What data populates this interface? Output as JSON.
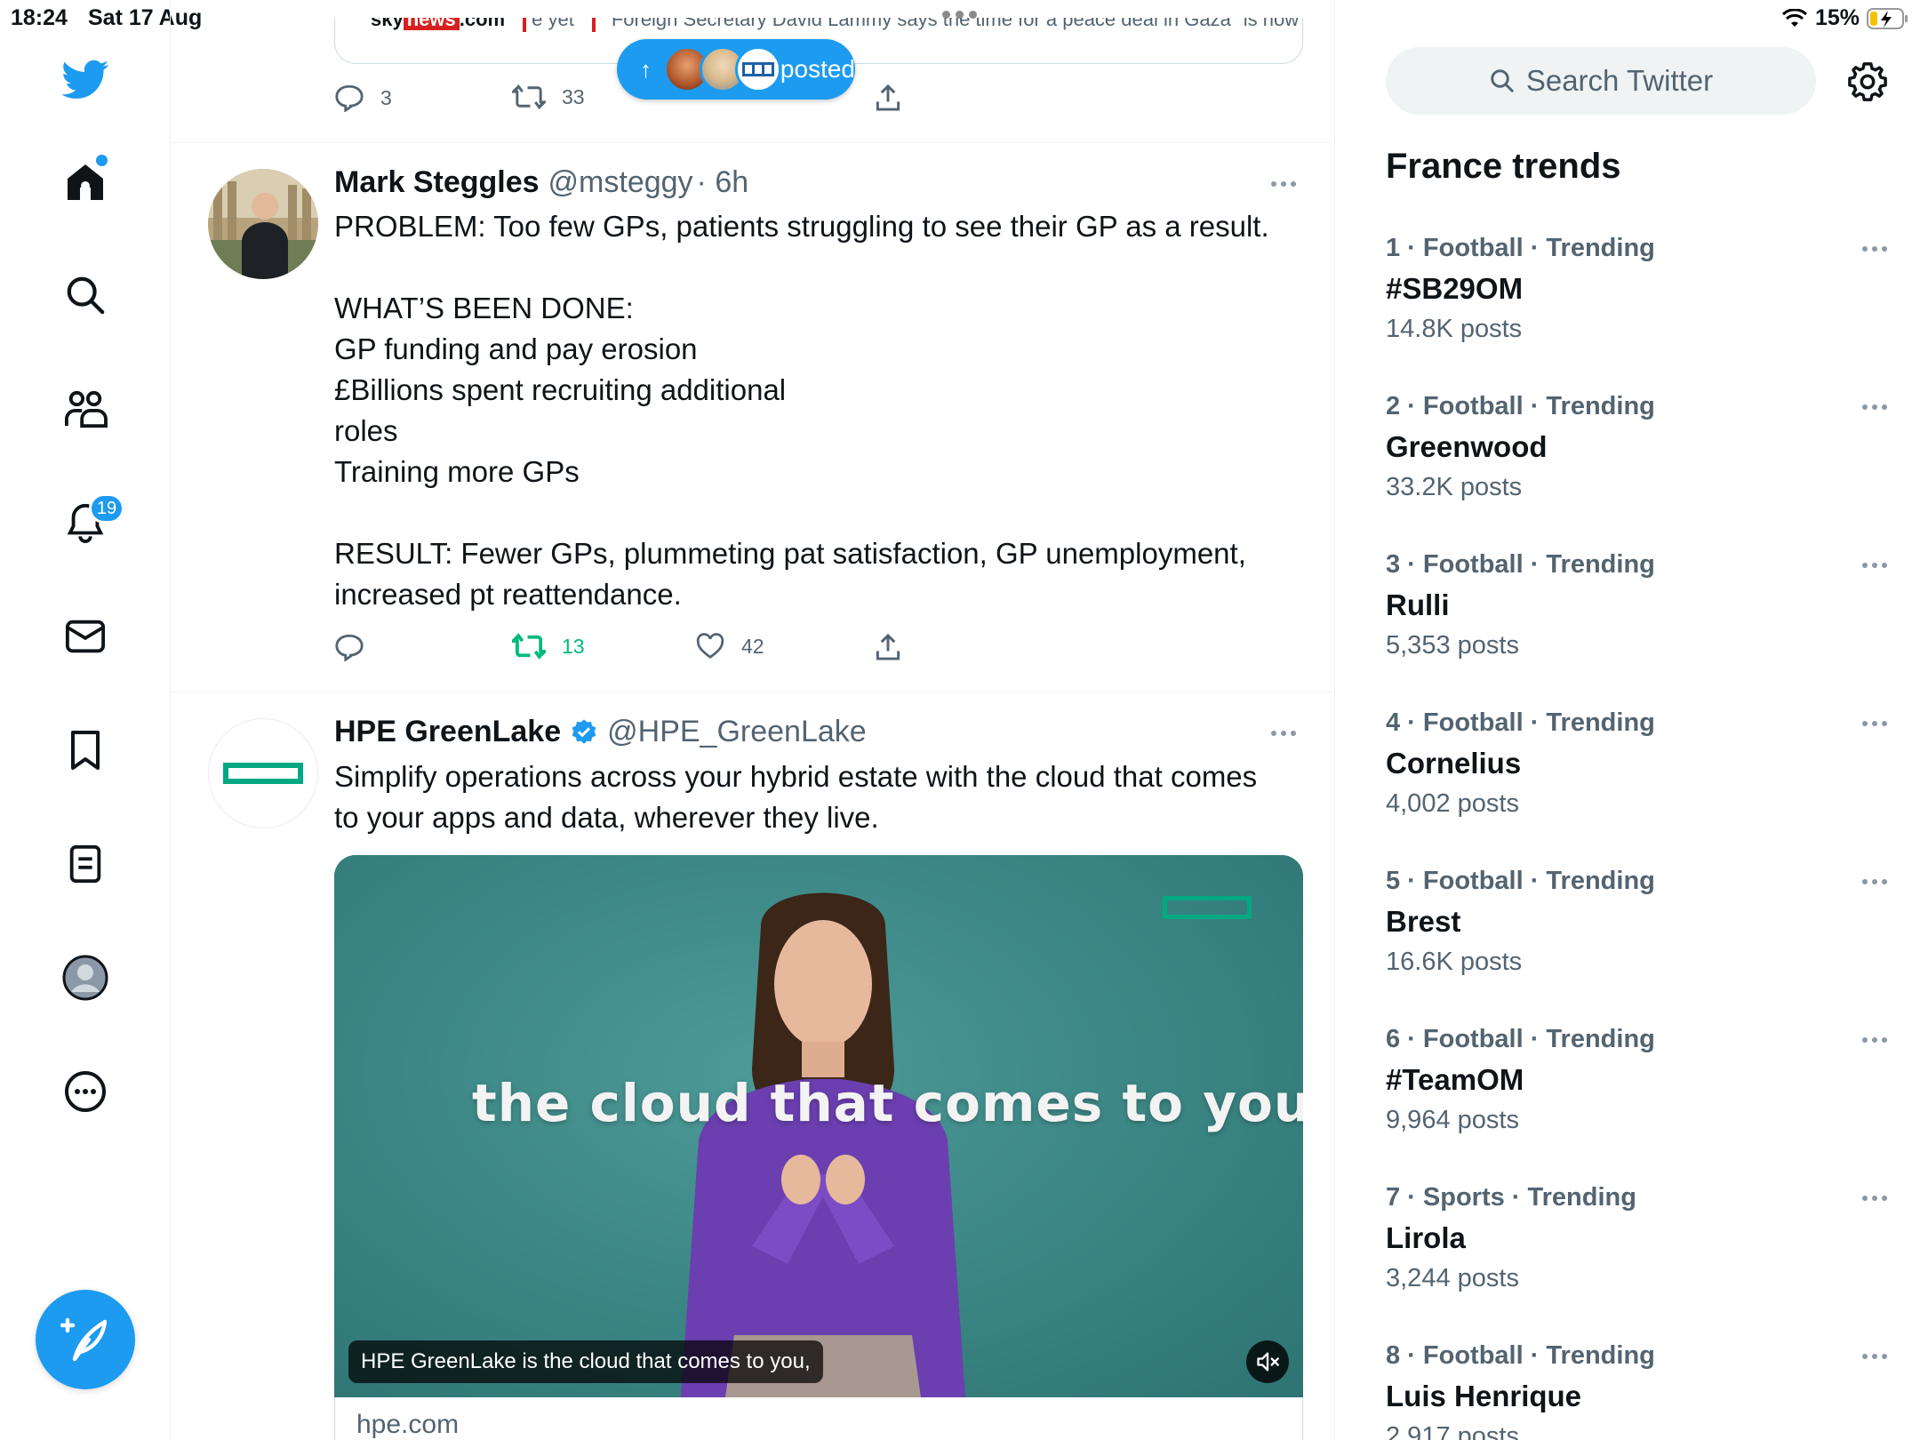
{
  "status_bar": {
    "time": "18:24",
    "date": "Sat 17 Aug",
    "battery": "15%"
  },
  "colors": {
    "accent": "#1d9bf0",
    "retweet_green": "#00ba7c",
    "hpe_green": "#01a982"
  },
  "nav": {
    "items": [
      {
        "icon": "twitter-bird-icon"
      },
      {
        "icon": "home-icon"
      },
      {
        "icon": "search-icon"
      },
      {
        "icon": "communities-icon"
      },
      {
        "icon": "notifications-bell-icon"
      },
      {
        "icon": "messages-envelope-icon"
      },
      {
        "icon": "bookmark-icon"
      },
      {
        "icon": "lists-icon"
      },
      {
        "icon": "profile-avatar-icon"
      },
      {
        "icon": "more-circle-icon"
      }
    ],
    "notifications_badge": "19",
    "compose_icon": "compose-feather-icon"
  },
  "timeline": {
    "prev_tweet": {
      "card_source": "sky",
      "card_source_highlight": "news",
      "card_source_suffix": ".com",
      "card_snippet_a": "e yet",
      "card_snippet_b": "Foreign Secretary David Lammy says the time for a peace deal in Gaza \"is now\"",
      "replies": "3",
      "retweets": "33"
    },
    "new_posts_pill": {
      "label": "posted"
    },
    "tweets": [
      {
        "name": "Mark Steggles",
        "handle": "@msteggy",
        "time": "· 6h",
        "text": "PROBLEM: Too few GPs, patients struggling to see their GP as a result.\n\nWHAT’S BEEN DONE:\nGP funding and pay erosion\n£Billions spent recruiting additional\nroles\nTraining more GPs\n\nRESULT: Fewer GPs, plummeting pat satisfaction, GP unemployment,\nincreased pt reattendance.",
        "replies": "",
        "retweets": "13",
        "likes": "42"
      },
      {
        "name": "HPE GreenLake",
        "handle": "@HPE_GreenLake",
        "verified": true,
        "text": "Simplify operations across your hybrid estate with the cloud that comes\nto your apps and data, wherever they live.",
        "video_overlay_text": "the cloud that comes to  you",
        "video_caption": "HPE GreenLake is the cloud that comes to you,",
        "link_domain": "hpe.com"
      }
    ]
  },
  "sidebar": {
    "search_placeholder": "Search Twitter",
    "trends_title": "France trends",
    "trends": [
      {
        "meta": "1 · Football · Trending",
        "name": "#SB29OM",
        "count": "14.8K posts"
      },
      {
        "meta": "2 · Football · Trending",
        "name": "Greenwood",
        "count": "33.2K posts"
      },
      {
        "meta": "3 · Football · Trending",
        "name": "Rulli",
        "count": "5,353 posts"
      },
      {
        "meta": "4 · Football · Trending",
        "name": "Cornelius",
        "count": "4,002 posts"
      },
      {
        "meta": "5 · Football · Trending",
        "name": "Brest",
        "count": "16.6K posts"
      },
      {
        "meta": "6 · Football · Trending",
        "name": "#TeamOM",
        "count": "9,964 posts"
      },
      {
        "meta": "7 · Sports · Trending",
        "name": "Lirola",
        "count": "3,244 posts"
      },
      {
        "meta": "8 · Football · Trending",
        "name": "Luis Henrique",
        "count": "2,917 posts"
      }
    ]
  }
}
